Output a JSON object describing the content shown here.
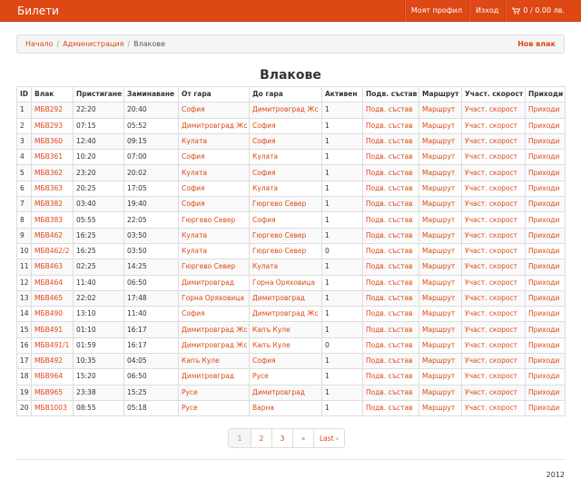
{
  "navbar": {
    "brand": "Билети",
    "profile": "Моят профил",
    "logout": "Изход",
    "cart": "0 / 0.00 лв."
  },
  "breadcrumb": {
    "home": "Начало",
    "admin": "Администрация",
    "current": "Влакове",
    "sep": "/",
    "new_train": "Нов влак"
  },
  "page_title": "Влакове",
  "table": {
    "headers": [
      "ID",
      "Влак",
      "Пристигане",
      "Заминаване",
      "От гара",
      "До гара",
      "Активен",
      "Подв. състав",
      "Маршрут",
      "Участ. скорост",
      "Приходи"
    ],
    "rows": [
      [
        "1",
        "МБВ292",
        "22:20",
        "20:40",
        "София",
        "Димитровград Жс",
        "1",
        "Подв. състав",
        "Маршрут",
        "Участ. скорост",
        "Приходи"
      ],
      [
        "2",
        "МБВ293",
        "07:15",
        "05:52",
        "Димитровград Жс",
        "София",
        "1",
        "Подв. състав",
        "Маршрут",
        "Участ. скорост",
        "Приходи"
      ],
      [
        "3",
        "МБВ360",
        "12:40",
        "09:15",
        "Кулата",
        "София",
        "1",
        "Подв. състав",
        "Маршрут",
        "Участ. скорост",
        "Приходи"
      ],
      [
        "4",
        "МБВ361",
        "10:20",
        "07:00",
        "София",
        "Кулата",
        "1",
        "Подв. състав",
        "Маршрут",
        "Участ. скорост",
        "Приходи"
      ],
      [
        "5",
        "МБВ362",
        "23:20",
        "20:02",
        "Кулата",
        "София",
        "1",
        "Подв. състав",
        "Маршрут",
        "Участ. скорост",
        "Приходи"
      ],
      [
        "6",
        "МБВ363",
        "20:25",
        "17:05",
        "София",
        "Кулата",
        "1",
        "Подв. състав",
        "Маршрут",
        "Участ. скорост",
        "Приходи"
      ],
      [
        "7",
        "МБВ382",
        "03:40",
        "19:40",
        "София",
        "Гюргево Север",
        "1",
        "Подв. състав",
        "Маршрут",
        "Участ. скорост",
        "Приходи"
      ],
      [
        "8",
        "МБВ383",
        "05:55",
        "22:05",
        "Гюргево Север",
        "София",
        "1",
        "Подв. състав",
        "Маршрут",
        "Участ. скорост",
        "Приходи"
      ],
      [
        "9",
        "МБВ462",
        "16:25",
        "03:50",
        "Кулата",
        "Гюргево Север",
        "1",
        "Подв. състав",
        "Маршрут",
        "Участ. скорост",
        "Приходи"
      ],
      [
        "10",
        "МБВ462/2",
        "16:25",
        "03:50",
        "Кулата",
        "Гюргево Север",
        "0",
        "Подв. състав",
        "Маршрут",
        "Участ. скорост",
        "Приходи"
      ],
      [
        "11",
        "МБВ463",
        "02:25",
        "14:25",
        "Гюргево Север",
        "Кулата",
        "1",
        "Подв. състав",
        "Маршрут",
        "Участ. скорост",
        "Приходи"
      ],
      [
        "12",
        "МБВ464",
        "11:40",
        "06:50",
        "Димитровград",
        "Горна Оряховица",
        "1",
        "Подв. състав",
        "Маршрут",
        "Участ. скорост",
        "Приходи"
      ],
      [
        "13",
        "МБВ465",
        "22:02",
        "17:48",
        "Горна Оряховица",
        "Димитровград",
        "1",
        "Подв. състав",
        "Маршрут",
        "Участ. скорост",
        "Приходи"
      ],
      [
        "14",
        "МБВ490",
        "13:10",
        "11:40",
        "София",
        "Димитровград Жс",
        "1",
        "Подв. състав",
        "Маршрут",
        "Участ. скорост",
        "Приходи"
      ],
      [
        "15",
        "МБВ491",
        "01:10",
        "16:17",
        "Димитровград Жс",
        "Капъ Куле",
        "1",
        "Подв. състав",
        "Маршрут",
        "Участ. скорост",
        "Приходи"
      ],
      [
        "16",
        "МБВ491/1",
        "01:59",
        "16:17",
        "Димитровград Жс",
        "Капъ Куле",
        "0",
        "Подв. състав",
        "Маршрут",
        "Участ. скорост",
        "Приходи"
      ],
      [
        "17",
        "МБВ492",
        "10:35",
        "04:05",
        "Капъ Куле",
        "София",
        "1",
        "Подв. състав",
        "Маршрут",
        "Участ. скорост",
        "Приходи"
      ],
      [
        "18",
        "МБВ964",
        "15:20",
        "06:50",
        "Димитровград",
        "Русе",
        "1",
        "Подв. състав",
        "Маршрут",
        "Участ. скорост",
        "Приходи"
      ],
      [
        "19",
        "МБВ965",
        "23:38",
        "15:25",
        "Русе",
        "Димитровград",
        "1",
        "Подв. състав",
        "Маршрут",
        "Участ. скорост",
        "Приходи"
      ],
      [
        "20",
        "МБВ1003",
        "08:55",
        "05:18",
        "Русе",
        "Варна",
        "1",
        "Подв. състав",
        "Маршрут",
        "Участ. скорост",
        "Приходи"
      ]
    ]
  },
  "pagination": [
    "1",
    "2",
    "3",
    "»",
    "Last ›"
  ],
  "footer": {
    "year": "2012"
  },
  "colors": {
    "accent": "#dd4814",
    "navbar": "#dd4814"
  }
}
